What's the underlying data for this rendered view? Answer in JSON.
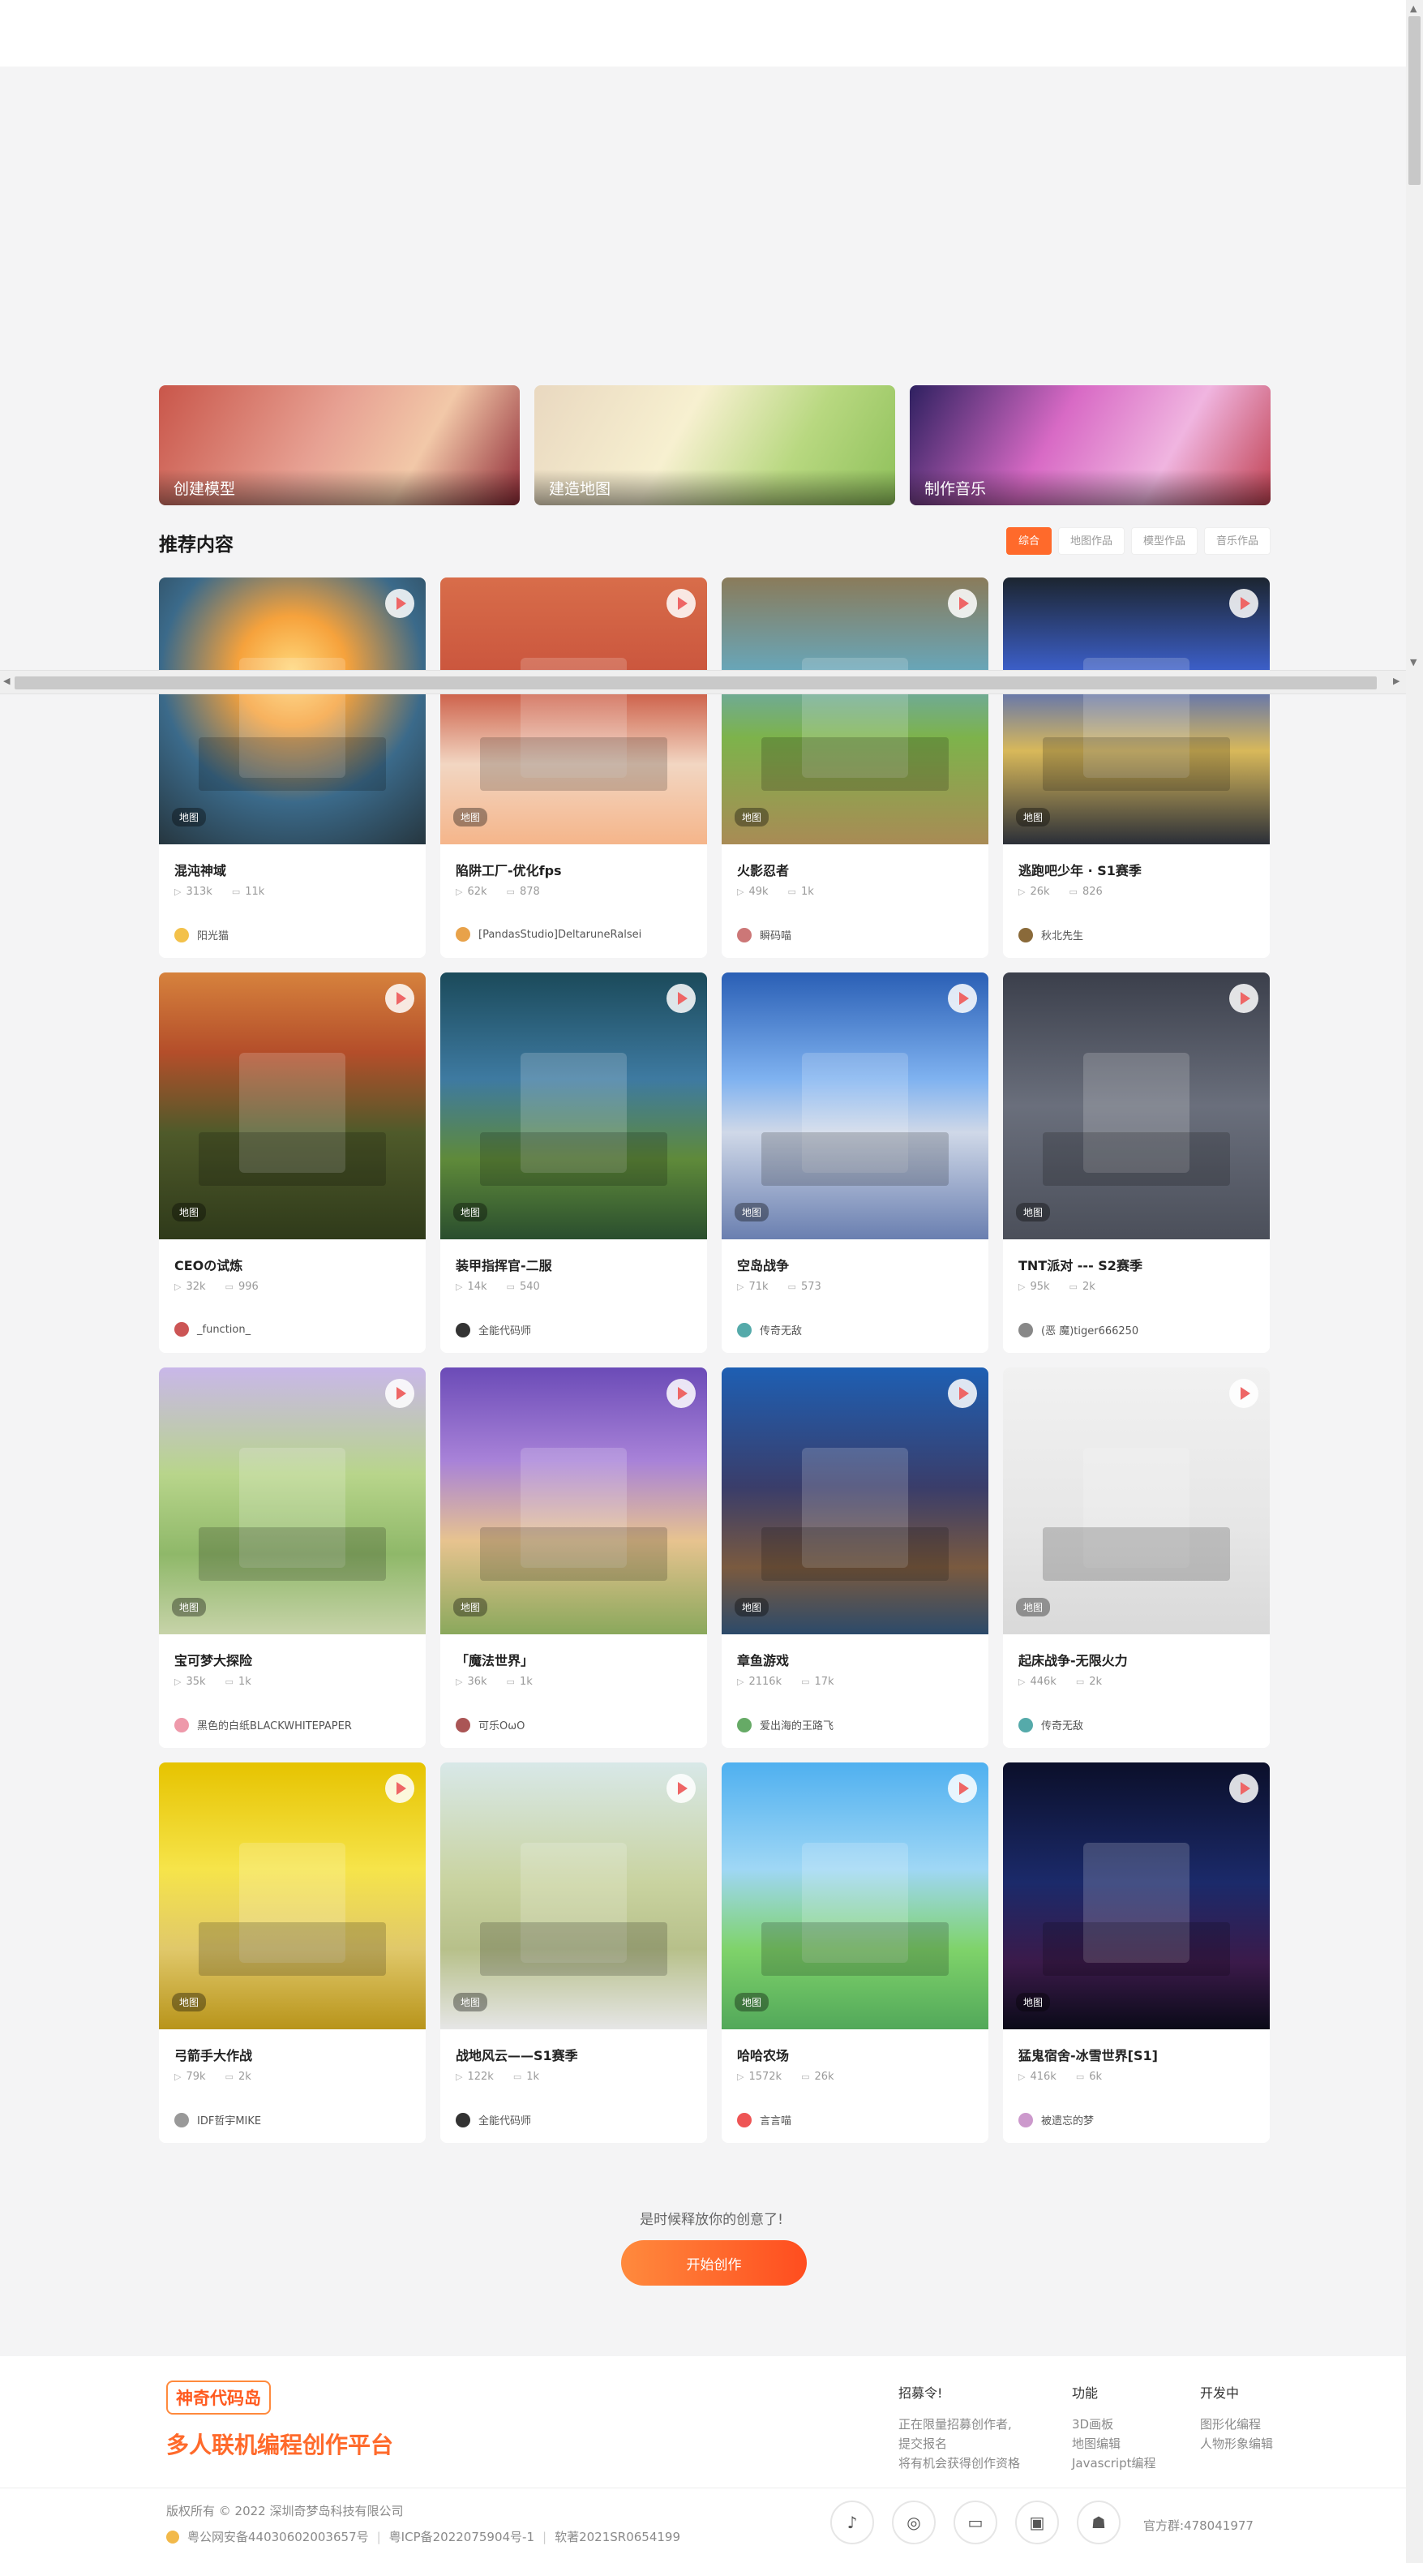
{
  "banners": [
    {
      "label": "创建模型"
    },
    {
      "label": "建造地图"
    },
    {
      "label": "制作音乐"
    }
  ],
  "section": {
    "title": "推荐内容",
    "filters": [
      "综合",
      "地图作品",
      "模型作品",
      "音乐作品"
    ]
  },
  "cards": [
    {
      "tag": "地图",
      "title": "混沌神域",
      "plays": "313k",
      "comments": "11k",
      "author": "阳光猫"
    },
    {
      "tag": "地图",
      "title": "陷阱工厂-优化fps",
      "plays": "62k",
      "comments": "878",
      "author": "[PandasStudio]DeltaruneRalsei"
    },
    {
      "tag": "地图",
      "title": "火影忍者",
      "plays": "49k",
      "comments": "1k",
      "author": "瞬码喵"
    },
    {
      "tag": "地图",
      "title": "逃跑吧少年 · S1赛季",
      "plays": "26k",
      "comments": "826",
      "author": "秋北先生"
    },
    {
      "tag": "地图",
      "title": "CEOの试炼",
      "plays": "32k",
      "comments": "996",
      "author": "_function_"
    },
    {
      "tag": "地图",
      "title": "装甲指挥官-二服",
      "plays": "14k",
      "comments": "540",
      "author": "全能代码师"
    },
    {
      "tag": "地图",
      "title": "空岛战争",
      "plays": "71k",
      "comments": "573",
      "author": "传奇无敌"
    },
    {
      "tag": "地图",
      "title": "TNT派对 --- S2赛季",
      "plays": "95k",
      "comments": "2k",
      "author": "(恶 魔)tiger666250"
    },
    {
      "tag": "地图",
      "title": "宝可梦大探险",
      "plays": "35k",
      "comments": "1k",
      "author": "黑色的白纸BLACKWHITEPAPER"
    },
    {
      "tag": "地图",
      "title": "「魔法世界」",
      "plays": "36k",
      "comments": "1k",
      "author": "可乐OωO"
    },
    {
      "tag": "地图",
      "title": "章鱼游戏",
      "plays": "2116k",
      "comments": "17k",
      "author": "爱出海的王路飞"
    },
    {
      "tag": "地图",
      "title": "起床战争-无限火力",
      "plays": "446k",
      "comments": "2k",
      "author": "传奇无敌"
    },
    {
      "tag": "地图",
      "title": "弓箭手大作战",
      "plays": "79k",
      "comments": "2k",
      "author": "IDF哲宇MIKE"
    },
    {
      "tag": "地图",
      "title": "战地风云——S1赛季",
      "plays": "122k",
      "comments": "1k",
      "author": "全能代码师"
    },
    {
      "tag": "地图",
      "title": "哈哈农场",
      "plays": "1572k",
      "comments": "26k",
      "author": "言言喵"
    },
    {
      "tag": "地图",
      "title": "猛鬼宿舍-冰雪世界[S1]",
      "plays": "416k",
      "comments": "6k",
      "author": "被遗忘的梦"
    }
  ],
  "cta": {
    "text": "是时候释放你的创意了!",
    "button": "开始创作"
  },
  "footer": {
    "logo": "神奇代码岛",
    "slogan": "多人联机编程创作平台",
    "col1": {
      "heading": "招募令!",
      "lines": [
        "正在限量招募创作者,",
        "提交报名",
        "将有机会获得创作资格"
      ]
    },
    "col2": {
      "heading": "功能",
      "lines": [
        "3D画板",
        "地图编辑",
        "Javascript编程"
      ]
    },
    "col3": {
      "heading": "开发中",
      "lines": [
        "图形化编程",
        "人物形象编辑"
      ]
    },
    "copyright": "版权所有 © 2022 深圳奇梦岛科技有限公司",
    "police": "粤公网安备44030602003657号",
    "icp": "粤ICP备2022075904号-1",
    "soft": "软著2021SR0654199",
    "qq": "官方群:478041977"
  },
  "colors": {
    "accent": "#ff6a2b",
    "background": "#f4f4f5"
  }
}
